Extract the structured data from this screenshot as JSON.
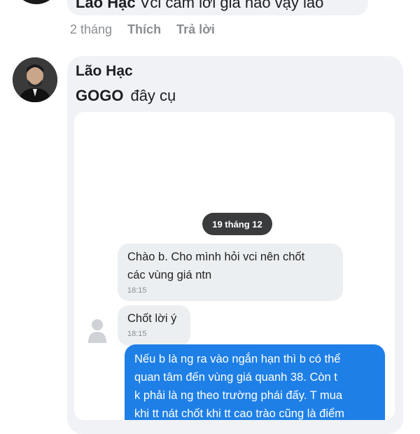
{
  "top_comment": {
    "author": "Lão Hạc",
    "text": "Vci cảm lời giá nào vậy lão",
    "time": "2 tháng",
    "like_label": "Thích",
    "reply_label": "Trả lời"
  },
  "comment": {
    "author": "Lão Hạc",
    "text_bold": "GOGO",
    "text": "đây cụ"
  },
  "chat": {
    "date_label": "19 tháng 12",
    "messages": [
      {
        "lines": [
          "Chào b. Cho mình hỏi vci nên chốt",
          "các vùng giá ntn"
        ],
        "time": "18:15"
      },
      {
        "lines": [
          "Chốt lời ý"
        ],
        "time": "18:15"
      },
      {
        "lines": [
          "Nếu b là ng ra vào ngắn hạn thì b có thể",
          "quan tâm đến vùng giá quanh 38. Còn t",
          "k phải là ng theo trường phái đấy. T mua",
          "khi tt nát chốt khi tt cao trào cũng là điểm"
        ]
      }
    ]
  },
  "colors": {
    "bubble_bg": "#f0f2f5",
    "outgoing": "#1e7fe6",
    "date_pill": "#3a3b3c"
  }
}
